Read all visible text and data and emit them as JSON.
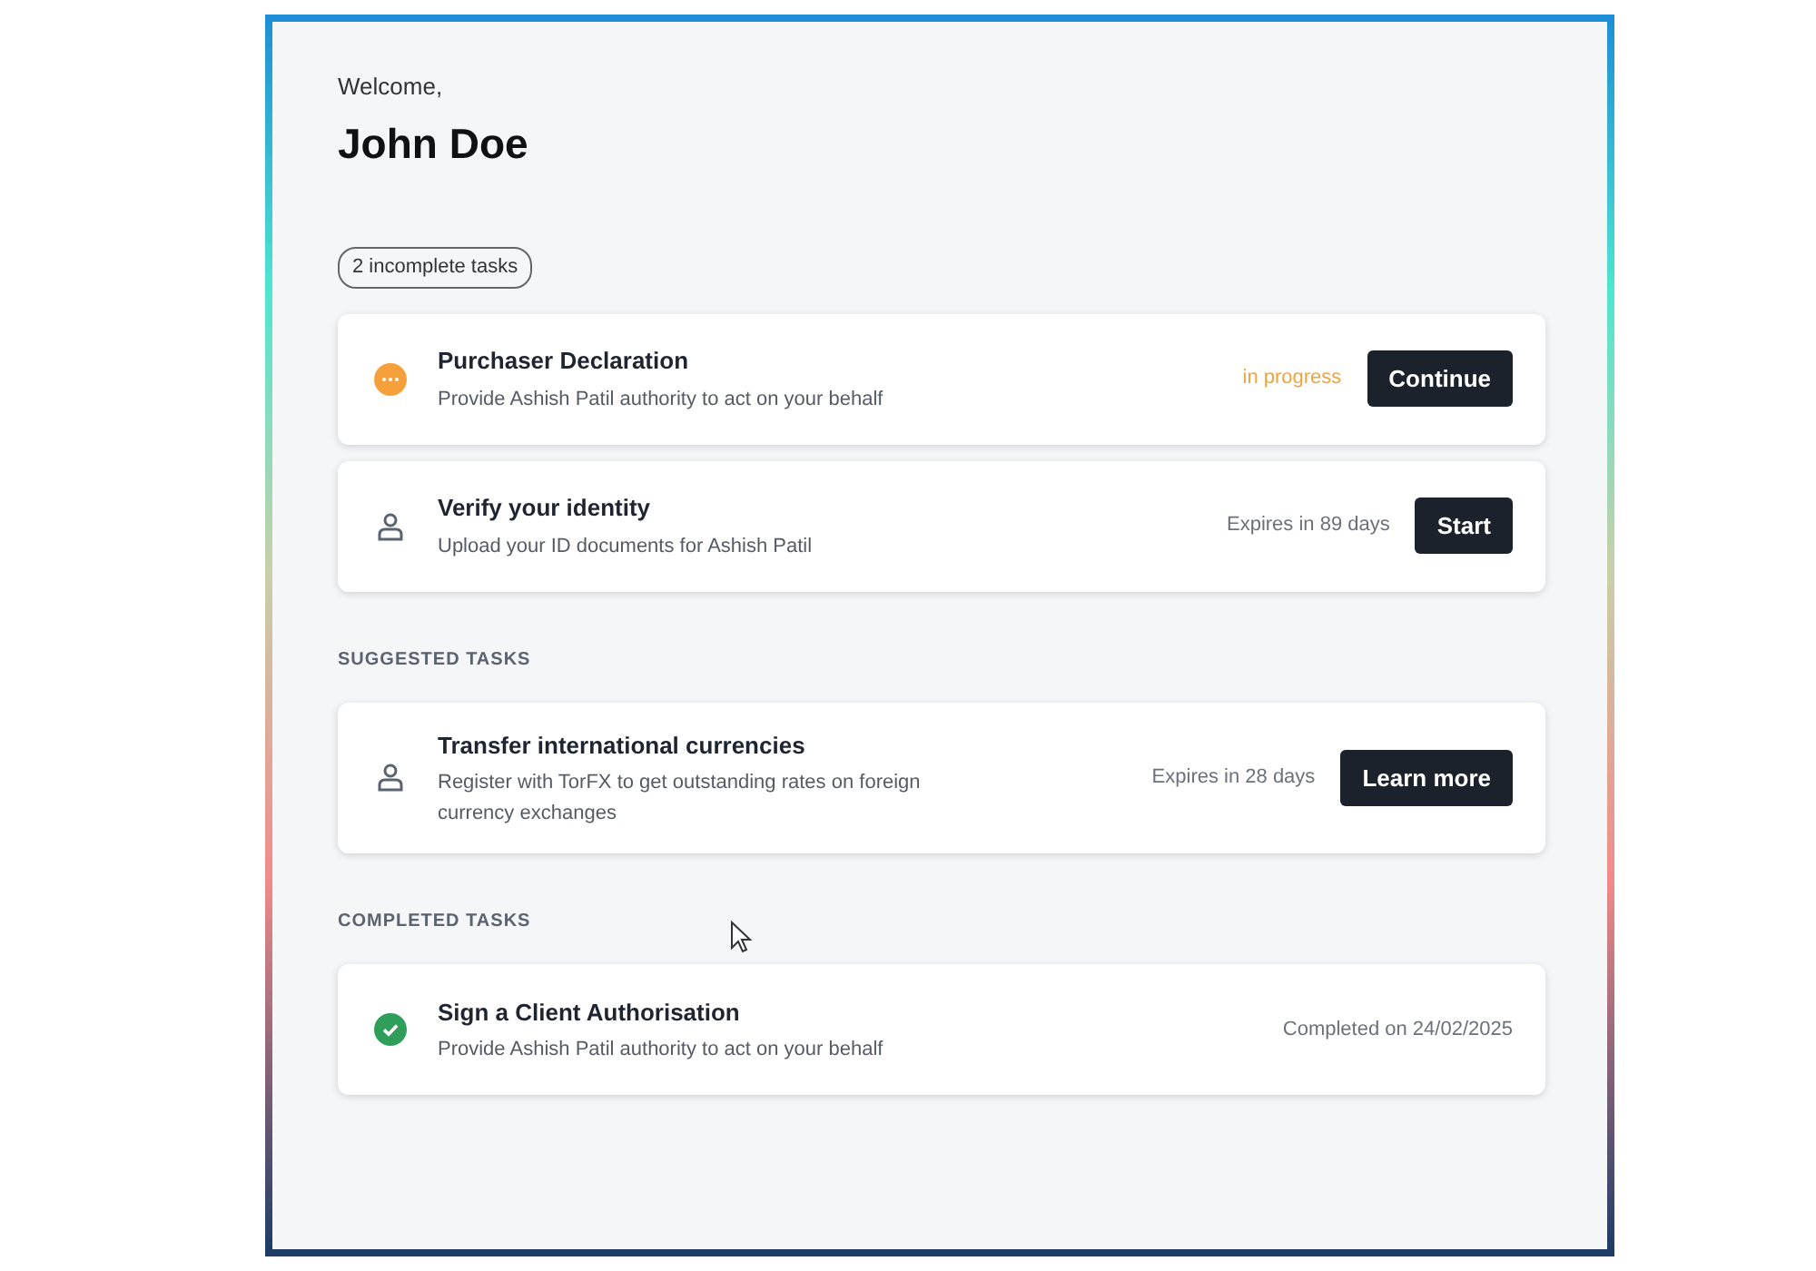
{
  "greeting": "Welcome,",
  "user_name": "John Doe",
  "sections": [
    {
      "kind": "badge",
      "label": "2 incomplete tasks",
      "tasks": [
        {
          "kind": "in_progress",
          "title": "Purchaser Declaration",
          "description": "Provide Ashish Patil authority to act on your behalf",
          "status_text": "in progress",
          "button": "Continue"
        },
        {
          "kind": "pending",
          "title": "Verify your identity",
          "description": "Upload your ID documents for Ashish Patil",
          "status_text": "Expires in 89 days",
          "button": "Start"
        }
      ]
    },
    {
      "kind": "heading",
      "label": "SUGGESTED TASKS",
      "tasks": [
        {
          "kind": "pending",
          "title": "Transfer international currencies",
          "description": "Register with TorFX to get outstanding rates on foreign currency exchanges",
          "status_text": "Expires in 28 days",
          "button": "Learn more"
        }
      ]
    },
    {
      "kind": "heading",
      "label": "COMPLETED TASKS",
      "tasks": [
        {
          "kind": "completed",
          "title": "Sign a Client Authorisation",
          "description": "Provide Ashish Patil authority to act on your behalf",
          "status_text": "Completed on 24/02/2025"
        }
      ]
    }
  ]
}
